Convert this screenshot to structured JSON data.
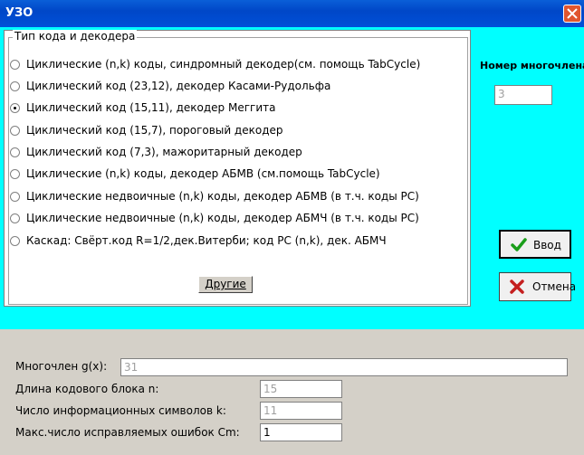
{
  "window": {
    "title": "УЗО"
  },
  "code_group": {
    "legend": "Тип кода и декодера",
    "options": [
      {
        "label": "Циклические (n,k) коды, синдромный декодер(см. помощь TabCycle)",
        "selected": false
      },
      {
        "label": "Циклический код (23,12), декодер Касами-Рудольфа",
        "selected": false
      },
      {
        "label": "Циклический код (15,11), декодер Меггита",
        "selected": true
      },
      {
        "label": "Циклический код (15,7), пороговый декодер",
        "selected": false
      },
      {
        "label": "Циклический код (7,3), мажоритарный декодер",
        "selected": false
      },
      {
        "label": "Циклические (n,k) коды, декодер АБМВ (см.помощь TabCycle)",
        "selected": false
      },
      {
        "label": "Циклические недвоичные (n,k) коды, декодер АБМВ (в т.ч. коды РС)",
        "selected": false
      },
      {
        "label": "Циклические недвоичные (n,k) коды, декодер АБМЧ (в т.ч. коды РС)",
        "selected": false
      },
      {
        "label": "Каскад: Свёрт.код R=1/2,дек.Витерби; код РС (n,k), дек. АБМЧ",
        "selected": false
      }
    ],
    "other_button": "Другие"
  },
  "polynomial_number": {
    "label": "Номер многочлена",
    "value": "3"
  },
  "buttons": {
    "ok": "Ввод",
    "cancel": "Отмена"
  },
  "fields": {
    "poly": {
      "label": "Многочлен g(x):",
      "value": "31"
    },
    "n": {
      "label": "Длина кодового блока  n:",
      "value": "15"
    },
    "k": {
      "label": "Число информационных символов  k:",
      "value": "11"
    },
    "cm": {
      "label": "Макс.число исправляемых ошибок Cm:",
      "value": "1"
    }
  },
  "colors": {
    "accent": "#00ffff",
    "titlebar": "#0050d8",
    "ok_icon": "#1a9e1a",
    "cancel_icon": "#c41f1f"
  }
}
